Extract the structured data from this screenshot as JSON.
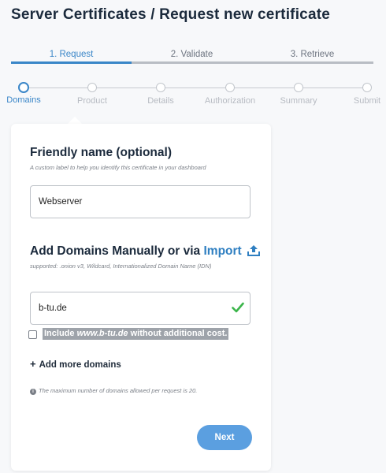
{
  "page": {
    "title": "Server Certificates / Request new certificate"
  },
  "tabs": [
    {
      "label": "1. Request",
      "active": true
    },
    {
      "label": "2. Validate",
      "active": false
    },
    {
      "label": "3. Retrieve",
      "active": false
    }
  ],
  "steps": [
    {
      "label": "Domains",
      "active": true
    },
    {
      "label": "Product",
      "active": false
    },
    {
      "label": "Details",
      "active": false
    },
    {
      "label": "Authorization",
      "active": false
    },
    {
      "label": "Summary",
      "active": false
    },
    {
      "label": "Submit",
      "active": false
    }
  ],
  "form": {
    "friendly_name": {
      "heading": "Friendly name (optional)",
      "hint": "A custom label to help you identify this certificate in your dashboard",
      "value": "Webserver"
    },
    "domains": {
      "heading_prefix": "Add Domains Manually or via",
      "import_label": "Import",
      "hint": "supported: .onion v3, Wildcard, Internationalized Domain Name (IDN)",
      "value": "b-tu.de",
      "include_prefix": "Include",
      "include_domain": "www.b-tu.de",
      "include_suffix": "without additional cost.",
      "include_checked": false,
      "add_more_label": "Add more domains",
      "info_text": "The maximum number of domains allowed per request is 20."
    },
    "next_label": "Next"
  },
  "colors": {
    "accent": "#3a86c8",
    "button": "#5b9fe0",
    "valid": "#3bb54a"
  },
  "icons": {
    "upload": "upload-icon",
    "valid": "check-icon",
    "info": "info-icon",
    "plus": "plus-icon"
  }
}
